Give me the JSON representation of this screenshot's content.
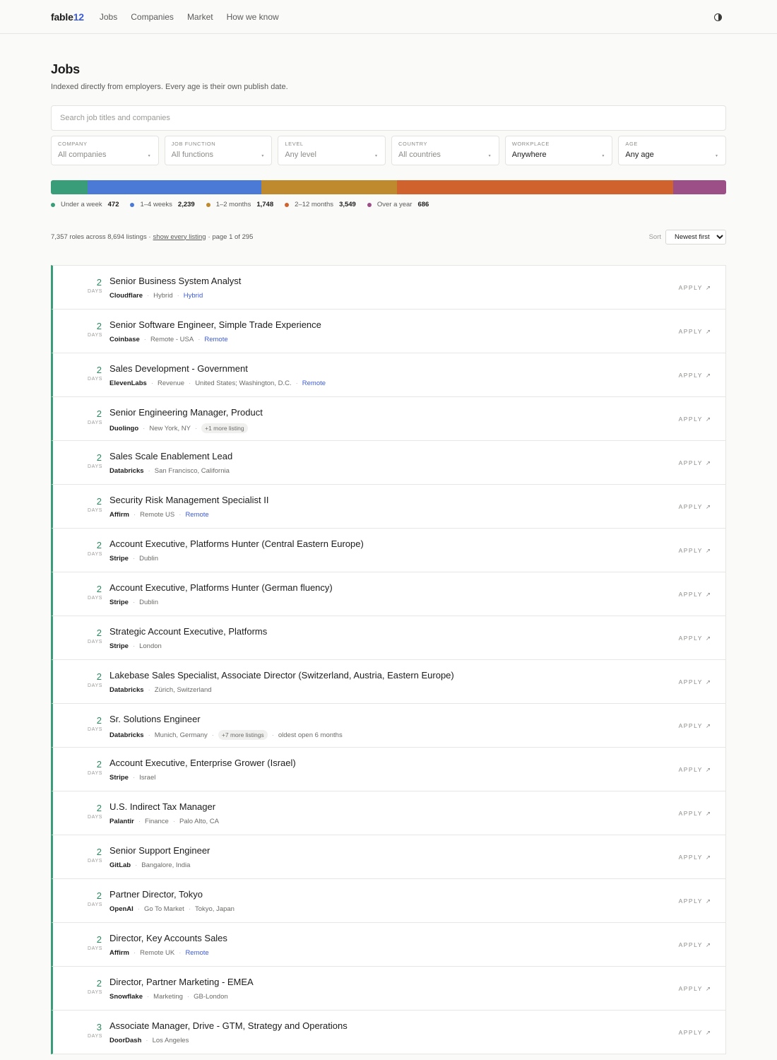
{
  "nav": {
    "logo_text": "fable",
    "logo_num": "12",
    "links": [
      "Jobs",
      "Companies",
      "Market",
      "How we know"
    ]
  },
  "header": {
    "title": "Jobs",
    "subtitle": "Indexed directly from employers. Every age is their own publish date."
  },
  "search": {
    "placeholder": "Search job titles and companies"
  },
  "filters": [
    {
      "label": "COMPANY",
      "value": "All companies",
      "set": false
    },
    {
      "label": "JOB FUNCTION",
      "value": "All functions",
      "set": false
    },
    {
      "label": "LEVEL",
      "value": "Any level",
      "set": false
    },
    {
      "label": "COUNTRY",
      "value": "All countries",
      "set": false
    },
    {
      "label": "WORKPLACE",
      "value": "Anywhere",
      "set": true
    },
    {
      "label": "AGE",
      "value": "Any age",
      "set": true
    }
  ],
  "age_distribution": [
    {
      "label": "Under a week",
      "count": "472",
      "value": 472,
      "color": "#3a9d7a"
    },
    {
      "label": "1–4 weeks",
      "count": "2,239",
      "value": 2239,
      "color": "#4a79d6"
    },
    {
      "label": "1–2 months",
      "count": "1,748",
      "value": 1748,
      "color": "#bf8a2e"
    },
    {
      "label": "2–12 months",
      "count": "3,549",
      "value": 3549,
      "color": "#d0622e"
    },
    {
      "label": "Over a year",
      "count": "686",
      "value": 686,
      "color": "#9c4e87"
    }
  ],
  "results": {
    "summary_prefix": "7,357 roles across 8,694 listings ·",
    "show_link": "show every listing",
    "summary_suffix": "· page 1 of 295",
    "sort_label": "Sort",
    "sort_value": "Newest first"
  },
  "apply_label": "APPLY",
  "age_unit": "DAYS",
  "jobs": [
    {
      "age": "2",
      "title": "Senior Business System Analyst",
      "company": "Cloudflare",
      "details": [
        "Hybrid"
      ],
      "tag": "Hybrid"
    },
    {
      "age": "2",
      "title": "Senior Software Engineer, Simple Trade Experience",
      "company": "Coinbase",
      "details": [
        "Remote - USA"
      ],
      "tag": "Remote"
    },
    {
      "age": "2",
      "title": "Sales Development - Government",
      "company": "ElevenLabs",
      "details": [
        "Revenue",
        "United States; Washington, D.C."
      ],
      "tag": "Remote"
    },
    {
      "age": "2",
      "title": "Senior Engineering Manager, Product",
      "company": "Duolingo",
      "details": [
        "New York, NY"
      ],
      "pill": "+1 more listing"
    },
    {
      "age": "2",
      "title": "Sales Scale Enablement Lead",
      "company": "Databricks",
      "details": [
        "San Francisco, California"
      ]
    },
    {
      "age": "2",
      "title": "Security Risk Management Specialist II",
      "company": "Affirm",
      "details": [
        "Remote US"
      ],
      "tag": "Remote"
    },
    {
      "age": "2",
      "title": "Account Executive, Platforms Hunter (Central Eastern Europe)",
      "company": "Stripe",
      "details": [
        "Dublin"
      ]
    },
    {
      "age": "2",
      "title": "Account Executive, Platforms Hunter (German fluency)",
      "company": "Stripe",
      "details": [
        "Dublin"
      ]
    },
    {
      "age": "2",
      "title": "Strategic Account Executive, Platforms",
      "company": "Stripe",
      "details": [
        "London"
      ]
    },
    {
      "age": "2",
      "title": "Lakebase Sales Specialist, Associate Director (Switzerland, Austria, Eastern Europe)",
      "company": "Databricks",
      "details": [
        "Zürich, Switzerland"
      ]
    },
    {
      "age": "2",
      "title": "Sr. Solutions Engineer",
      "company": "Databricks",
      "details": [
        "Munich, Germany"
      ],
      "pill": "+7 more listings",
      "extra": "oldest open 6 months"
    },
    {
      "age": "2",
      "title": "Account Executive, Enterprise Grower (Israel)",
      "company": "Stripe",
      "details": [
        "Israel"
      ]
    },
    {
      "age": "2",
      "title": "U.S. Indirect Tax Manager",
      "company": "Palantir",
      "details": [
        "Finance",
        "Palo Alto, CA"
      ]
    },
    {
      "age": "2",
      "title": "Senior Support Engineer",
      "company": "GitLab",
      "details": [
        "Bangalore, India"
      ]
    },
    {
      "age": "2",
      "title": "Partner Director, Tokyo",
      "company": "OpenAI",
      "details": [
        "Go To Market",
        "Tokyo, Japan"
      ]
    },
    {
      "age": "2",
      "title": "Director, Key Accounts Sales",
      "company": "Affirm",
      "details": [
        "Remote UK"
      ],
      "tag": "Remote"
    },
    {
      "age": "2",
      "title": "Director, Partner Marketing - EMEA",
      "company": "Snowflake",
      "details": [
        "Marketing",
        "GB-London"
      ]
    },
    {
      "age": "3",
      "title": "Associate Manager, Drive - GTM, Strategy and Operations",
      "company": "DoorDash",
      "details": [
        "Los Angeles"
      ]
    }
  ]
}
